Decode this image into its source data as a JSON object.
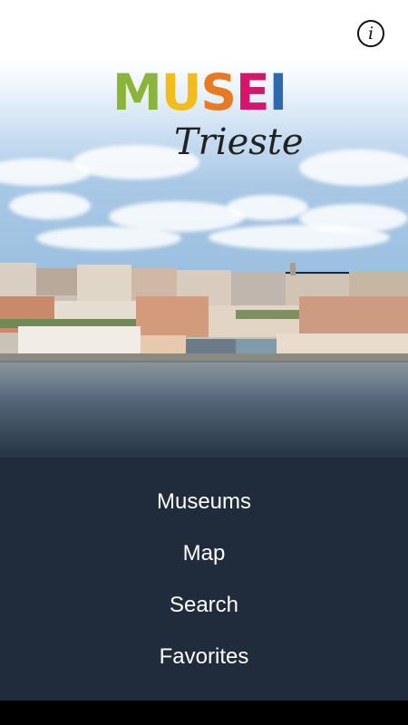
{
  "app": {
    "logo_letters": [
      {
        "char": "M",
        "color": "#8bb53a"
      },
      {
        "char": "U",
        "color": "#f2bd1b"
      },
      {
        "char": "S",
        "color": "#e87a24"
      },
      {
        "char": "E",
        "color": "#d4176a"
      },
      {
        "char": "I",
        "color": "#2c69b0"
      }
    ],
    "subtitle": "Trieste",
    "info_icon": "info-icon",
    "info_glyph": "i"
  },
  "menu": {
    "items": [
      {
        "label": "Museums"
      },
      {
        "label": "Map"
      },
      {
        "label": "Search"
      },
      {
        "label": "Favorites"
      }
    ]
  },
  "colors": {
    "bottom_panel": "#202c3b",
    "menu_text": "#ffffff"
  }
}
